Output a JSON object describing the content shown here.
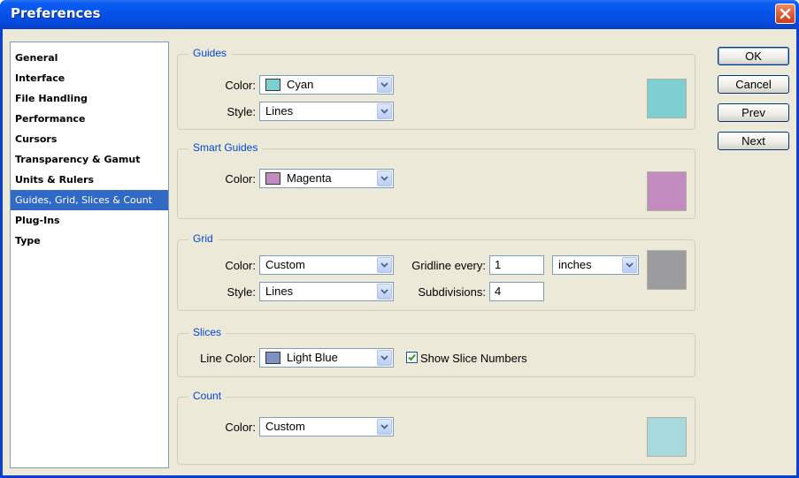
{
  "window": {
    "title": "Preferences"
  },
  "sidebar": {
    "items": [
      {
        "label": "General"
      },
      {
        "label": "Interface"
      },
      {
        "label": "File Handling"
      },
      {
        "label": "Performance"
      },
      {
        "label": "Cursors"
      },
      {
        "label": "Transparency & Gamut"
      },
      {
        "label": "Units & Rulers"
      },
      {
        "label": "Guides, Grid, Slices & Count",
        "selected": true
      },
      {
        "label": "Plug-Ins"
      },
      {
        "label": "Type"
      }
    ]
  },
  "guides": {
    "legend": "Guides",
    "color_label": "Color:",
    "color_value": "Cyan",
    "color_hex": "#7ecfd1",
    "style_label": "Style:",
    "style_value": "Lines"
  },
  "smart_guides": {
    "legend": "Smart Guides",
    "color_label": "Color:",
    "color_value": "Magenta",
    "color_hex": "#c28cc0"
  },
  "grid": {
    "legend": "Grid",
    "color_label": "Color:",
    "color_value": "Custom",
    "color_hex": "#9c9c9f",
    "style_label": "Style:",
    "style_value": "Lines",
    "gridline_label": "Gridline every:",
    "gridline_value": "1",
    "unit_value": "inches",
    "subdivisions_label": "Subdivisions:",
    "subdivisions_value": "4"
  },
  "slices": {
    "legend": "Slices",
    "line_color_label": "Line Color:",
    "line_color_value": "Light Blue",
    "line_color_hex": "#7d90c7",
    "show_numbers_label": "Show Slice Numbers",
    "show_numbers_checked": true
  },
  "count": {
    "legend": "Count",
    "color_label": "Color:",
    "color_value": "Custom",
    "color_hex": "#a8dadd"
  },
  "buttons": {
    "ok": "OK",
    "cancel": "Cancel",
    "prev": "Prev",
    "next": "Next"
  },
  "colors": {
    "selection": "#316ac5",
    "legend_text": "#0046d5",
    "dialog_bg": "#ece9d8"
  }
}
